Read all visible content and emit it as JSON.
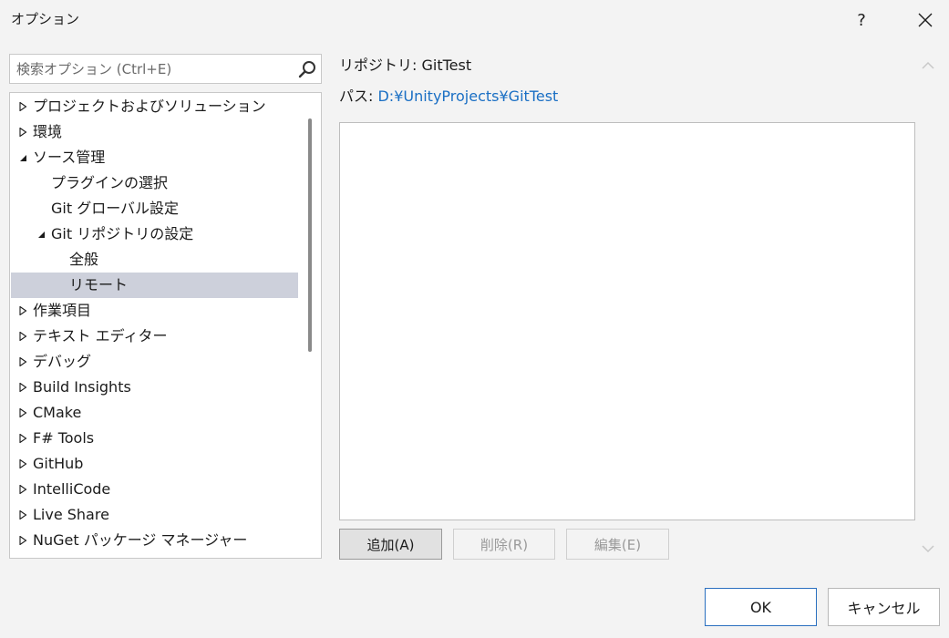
{
  "window": {
    "title": "オプション",
    "help_label": "?",
    "close_label": "✕"
  },
  "search": {
    "placeholder": "検索オプション (Ctrl+E)",
    "value": ""
  },
  "tree": {
    "items": [
      {
        "label": "プロジェクトおよびソリューション",
        "level": 0,
        "expander": "collapsed",
        "selected": false
      },
      {
        "label": "環境",
        "level": 0,
        "expander": "collapsed",
        "selected": false
      },
      {
        "label": "ソース管理",
        "level": 0,
        "expander": "expanded",
        "selected": false
      },
      {
        "label": "プラグインの選択",
        "level": 1,
        "expander": "none",
        "selected": false
      },
      {
        "label": "Git グローバル設定",
        "level": 1,
        "expander": "none",
        "selected": false
      },
      {
        "label": "Git リポジトリの設定",
        "level": 1,
        "expander": "expanded",
        "selected": false
      },
      {
        "label": "全般",
        "level": 2,
        "expander": "none",
        "selected": false
      },
      {
        "label": "リモート",
        "level": 2,
        "expander": "none",
        "selected": true
      },
      {
        "label": "作業項目",
        "level": 0,
        "expander": "collapsed",
        "selected": false
      },
      {
        "label": "テキスト エディター",
        "level": 0,
        "expander": "collapsed",
        "selected": false
      },
      {
        "label": "デバッグ",
        "level": 0,
        "expander": "collapsed",
        "selected": false
      },
      {
        "label": "Build Insights",
        "level": 0,
        "expander": "collapsed",
        "selected": false
      },
      {
        "label": "CMake",
        "level": 0,
        "expander": "collapsed",
        "selected": false
      },
      {
        "label": "F# Tools",
        "level": 0,
        "expander": "collapsed",
        "selected": false
      },
      {
        "label": "GitHub",
        "level": 0,
        "expander": "collapsed",
        "selected": false
      },
      {
        "label": "IntelliCode",
        "level": 0,
        "expander": "collapsed",
        "selected": false
      },
      {
        "label": "Live Share",
        "level": 0,
        "expander": "collapsed",
        "selected": false
      },
      {
        "label": "NuGet パッケージ マネージャー",
        "level": 0,
        "expander": "collapsed",
        "selected": false
      }
    ]
  },
  "panel": {
    "repo_label": "リポジトリ: ",
    "repo_name": "GitTest",
    "path_label": "パス: ",
    "path_value": "D:¥UnityProjects¥GitTest",
    "remotes": [],
    "add_label": "追加(A)",
    "delete_label": "削除(R)",
    "edit_label": "編集(E)"
  },
  "footer": {
    "ok_label": "OK",
    "cancel_label": "キャンセル"
  },
  "colors": {
    "accent": "#2a6fbf",
    "link": "#1a6fc4",
    "selected_row": "#cdd0db",
    "background": "#f3f3f3"
  },
  "icons": {
    "search": "search-icon",
    "close": "close-icon",
    "collapsed": "triangle-right-outline-icon",
    "expanded": "triangle-down-filled-icon",
    "scroll_up": "chevron-up-icon",
    "scroll_down": "chevron-down-icon"
  }
}
